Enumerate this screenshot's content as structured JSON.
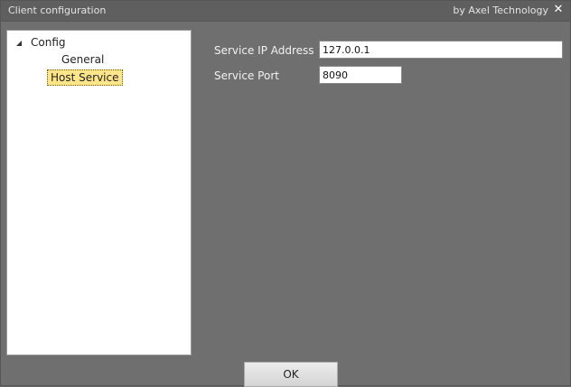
{
  "window": {
    "title": "Client configuration",
    "brand": "by Axel Technology",
    "close_glyph": "✕"
  },
  "tree": {
    "root_label": "Config",
    "children": [
      {
        "label": "General",
        "selected": false
      },
      {
        "label": "Host Service",
        "selected": true
      }
    ]
  },
  "form": {
    "ip_label": "Service IP Address",
    "ip_value": "127.0.0.1",
    "port_label": "Service Port",
    "port_value": "8090"
  },
  "footer": {
    "ok_label": "OK"
  },
  "colors": {
    "background": "#6f6f6f",
    "titlebar": "#5f5f5f",
    "selection": "#fde58a"
  },
  "icons": {
    "close": "close-icon",
    "expander": "expanded-triangle-icon"
  }
}
